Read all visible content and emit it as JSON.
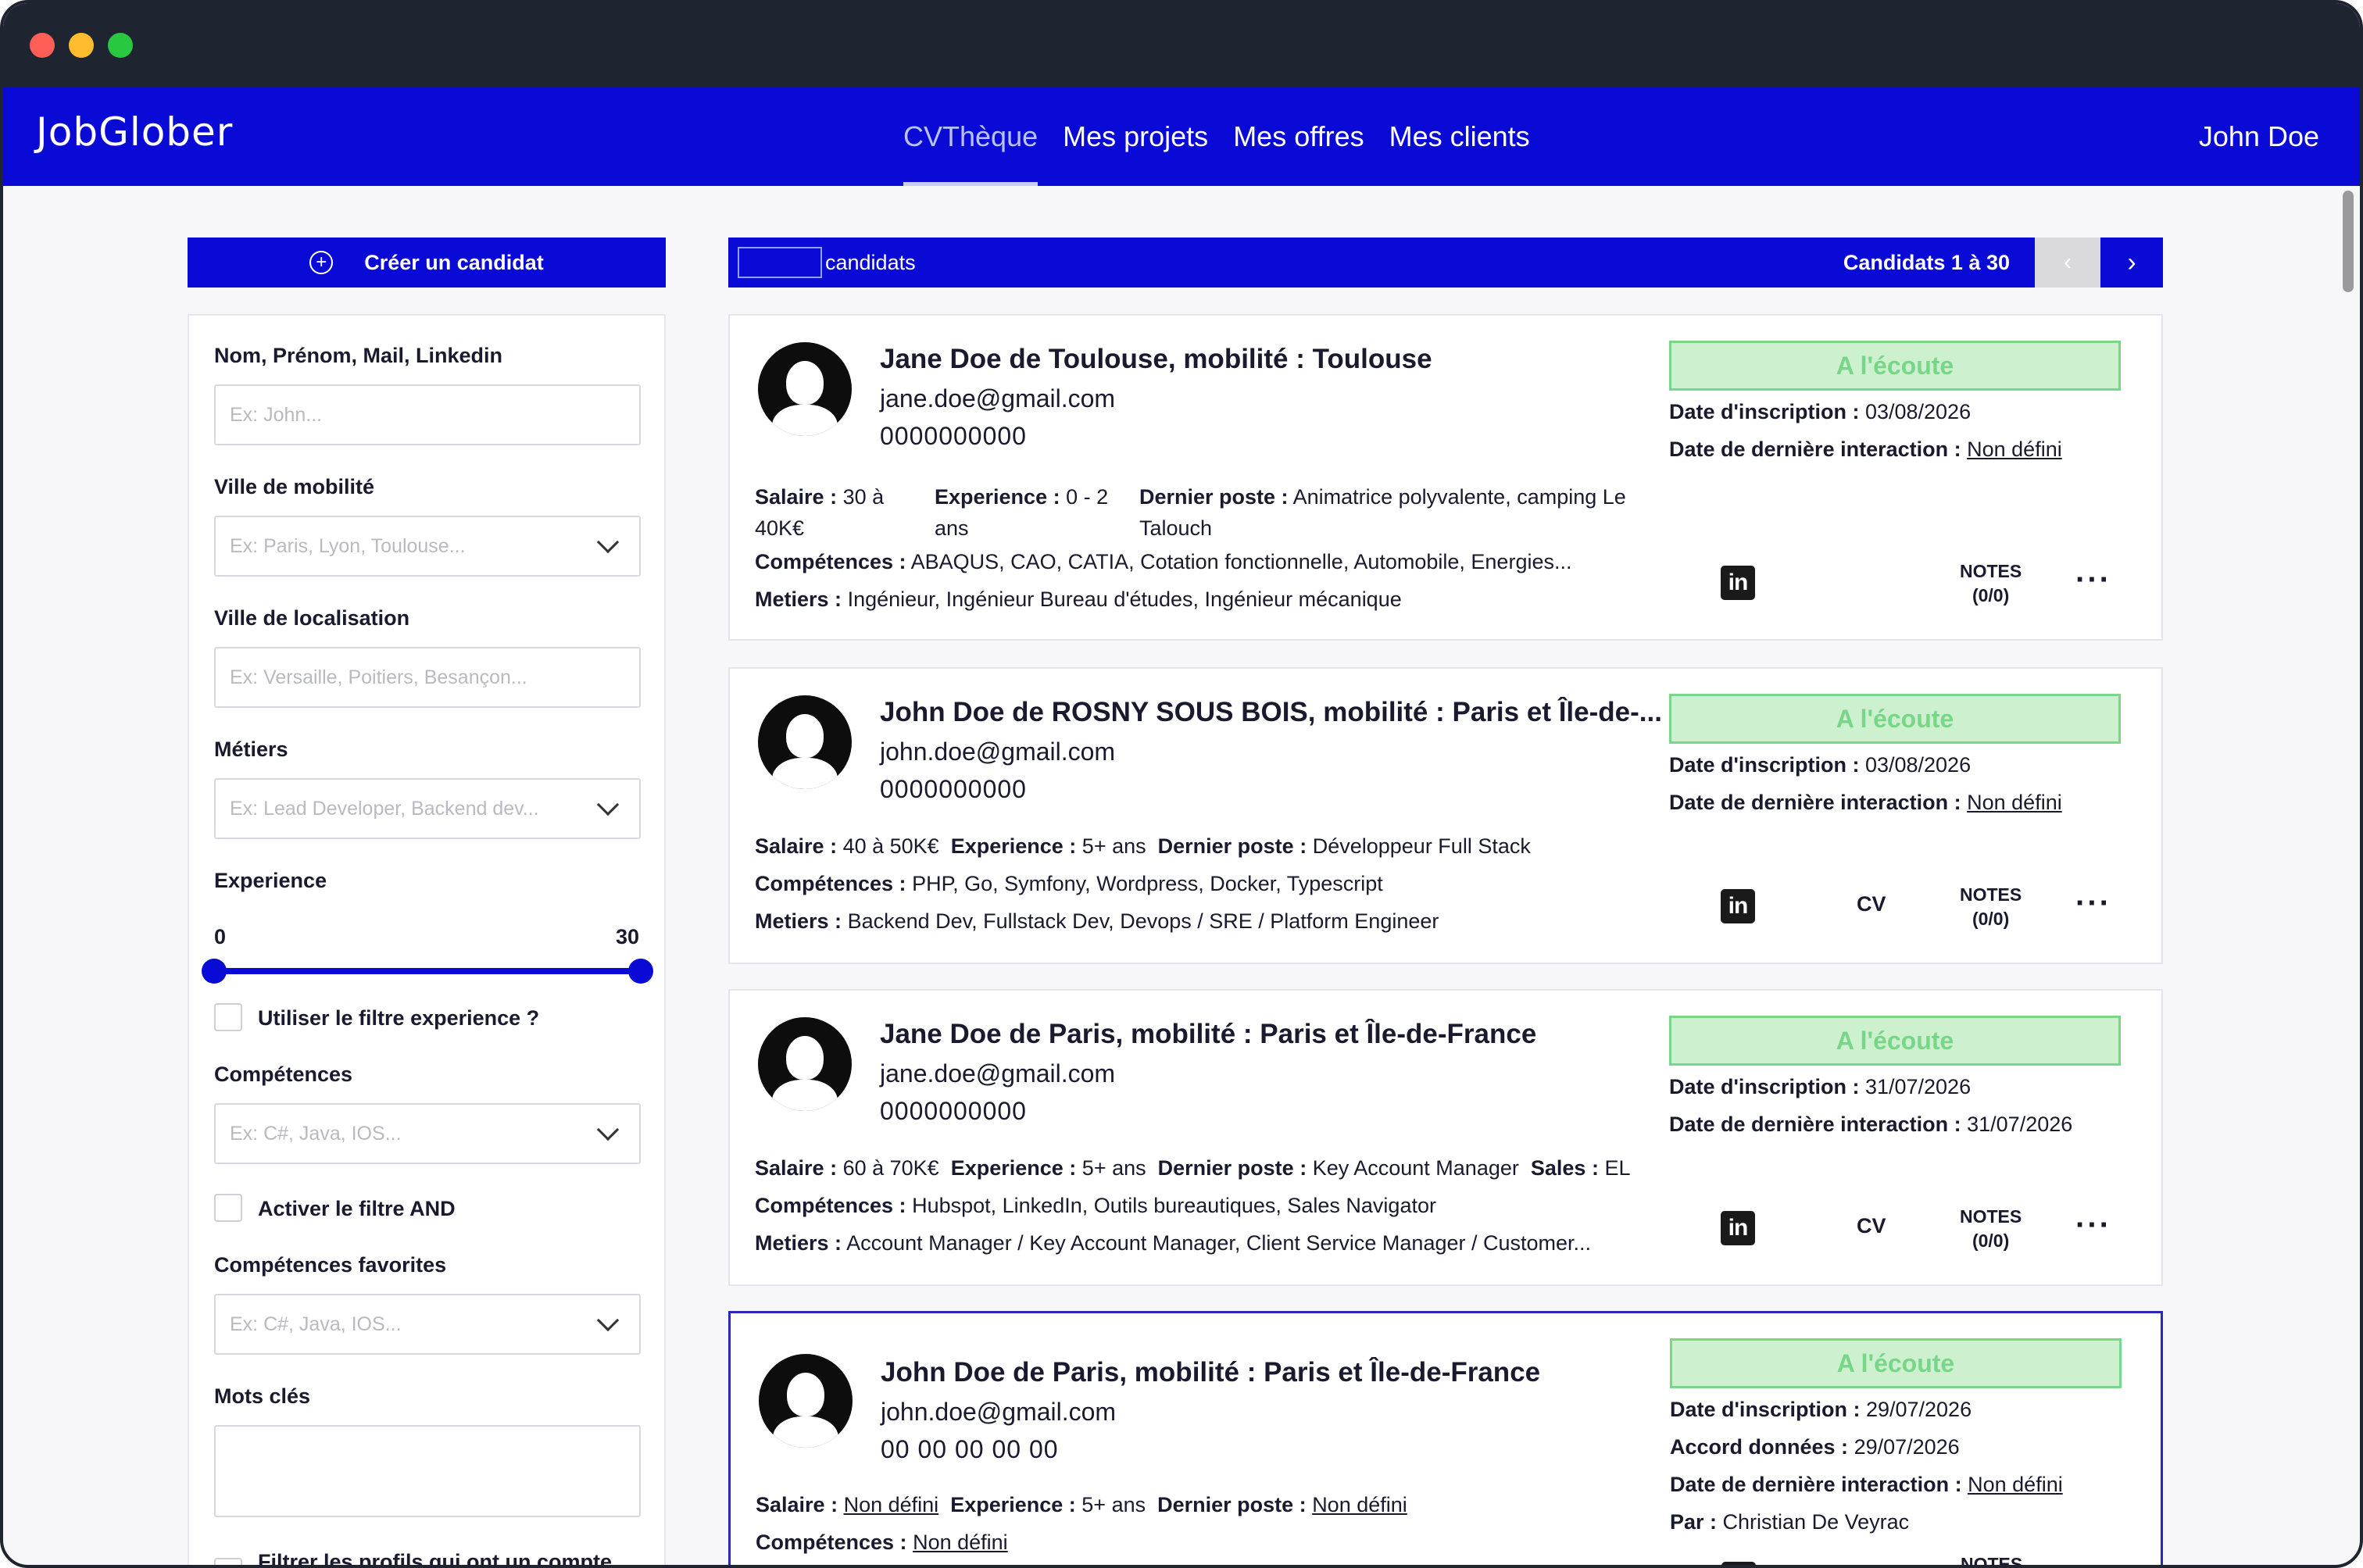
{
  "app": {
    "logo": "JobGlober",
    "nav": [
      "CVThèque",
      "Mes projets",
      "Mes offres",
      "Mes clients"
    ],
    "user": "John Doe"
  },
  "sidebar": {
    "create_label": "Créer un candidat",
    "name_label": "Nom, Prénom, Mail, Linkedin",
    "name_placeholder": "Ex: John...",
    "mobility_label": "Ville de mobilité",
    "mobility_placeholder": "Ex: Paris, Lyon, Toulouse...",
    "location_label": "Ville de localisation",
    "location_placeholder": "Ex: Versaille, Poitiers, Besançon...",
    "jobs_label": "Métiers",
    "jobs_placeholder": "Ex: Lead Developer, Backend dev...",
    "experience_label": "Experience",
    "experience_min": "0",
    "experience_max": "30",
    "experience_filter_label": "Utiliser le filtre experience ?",
    "skills_label": "Compétences",
    "skills_placeholder": "Ex: C#, Java, IOS...",
    "and_filter_label": "Activer le filtre AND",
    "fav_skills_label": "Compétences favorites",
    "fav_skills_placeholder": "Ex: C#, Java, IOS...",
    "keywords_label": "Mots clés",
    "account_filter_label": "Filtrer les profils qui ont un compte"
  },
  "list": {
    "count_label": "candidats",
    "range_label": "Candidats 1 à 30",
    "prev": "‹",
    "next": "›"
  },
  "labels": {
    "salary": "Salaire :",
    "experience": "Experience :",
    "last_job": "Dernier poste :",
    "skills": "Compétences :",
    "jobs": "Metiers :",
    "sales": "Sales :",
    "registered": "Date d'inscription :",
    "last_interaction": "Date de dernière interaction :",
    "data_agreement": "Accord données :",
    "by": "Par :",
    "cv": "CV",
    "notes": "NOTES",
    "linkedin": "in"
  },
  "candidates": [
    {
      "name": "Jane Doe de Toulouse, mobilité : Toulouse",
      "email": "jane.doe@gmail.com",
      "phone": "0000000000",
      "status": "A l'écoute",
      "salary": "30 à 40K€",
      "experience": "0 - 2 ans",
      "last_job": "Animatrice polyvalente, camping Le Talouch",
      "skills": "ABAQUS, CAO, CATIA, Cotation fonctionnelle, Automobile, Energies...",
      "jobs": "Ingénieur, Ingénieur Bureau d'études, Ingénieur mécanique",
      "registered": "03/08/2026",
      "last_interaction": "Non défini",
      "notes": "(0/0)"
    },
    {
      "name": "John Doe de ROSNY SOUS BOIS, mobilité : Paris et Île-de-...",
      "email": "john.doe@gmail.com",
      "phone": "0000000000",
      "status": "A l'écoute",
      "salary": "40 à 50K€",
      "experience": "5+ ans",
      "last_job": "Développeur Full Stack",
      "skills": "PHP, Go, Symfony, Wordpress, Docker, Typescript",
      "jobs": "Backend Dev, Fullstack Dev, Devops / SRE / Platform Engineer",
      "registered": "03/08/2026",
      "last_interaction": "Non défini",
      "notes": "(0/0)"
    },
    {
      "name": "Jane Doe de Paris, mobilité : Paris et Île-de-France",
      "email": "jane.doe@gmail.com",
      "phone": "0000000000",
      "status": "A l'écoute",
      "salary": "60 à 70K€",
      "experience": "5+ ans",
      "last_job": "Key Account Manager",
      "sales": "EL",
      "skills": "Hubspot, LinkedIn, Outils bureautiques, Sales Navigator",
      "jobs": "Account Manager / Key Account Manager, Client Service Manager / Customer...",
      "registered": "31/07/2026",
      "last_interaction": "31/07/2026",
      "notes": "(0/0)"
    },
    {
      "name": "John Doe de Paris, mobilité : Paris et Île-de-France",
      "email": "john.doe@gmail.com",
      "phone": "00 00 00 00 00",
      "status": "A l'écoute",
      "salary": "Non défini",
      "experience": "5+ ans",
      "last_job": "Non défini",
      "skills": "Non défini",
      "registered": "29/07/2026",
      "data_agreement": "29/07/2026",
      "last_interaction": "Non défini",
      "by": "Christian De Veyrac"
    }
  ],
  "colors": {
    "primary": "#0a0ad6",
    "status_bg": "#cdf0cf",
    "status_text": "#78d689"
  }
}
